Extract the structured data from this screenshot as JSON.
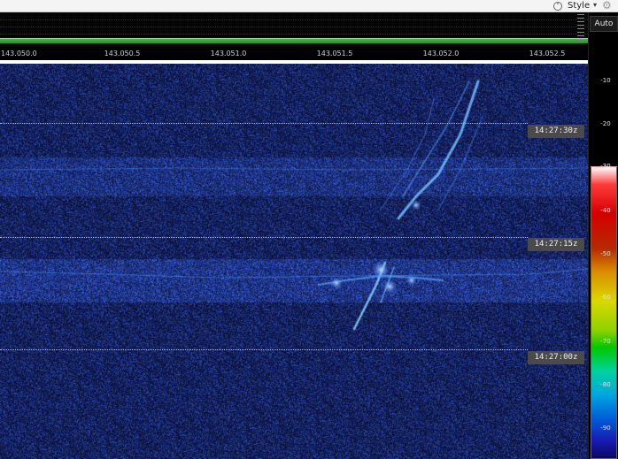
{
  "toolbar": {
    "collapse_icon": "chevron-up-circle-icon",
    "style_label": "Style",
    "style_caret": "▾",
    "settings_icon": "gear-icon"
  },
  "frequency_axis": {
    "ticks": [
      "143.050.0",
      "143.050.5",
      "143.051.0",
      "143.051.5",
      "143.052.0",
      "143.052.5"
    ]
  },
  "waterfall": {
    "timestamps": [
      "14:27:30z",
      "14:27:15z",
      "14:27:00z"
    ]
  },
  "color_scale": {
    "mode_button": "Auto",
    "labels": [
      "-10",
      "-20",
      "-30",
      "-40",
      "-50",
      "-60",
      "-70",
      "-80",
      "-90"
    ]
  },
  "colors": {
    "waterfall_background": "#030a3a",
    "signal": "#5fb4ff",
    "spectrum_level": "#3dbb3d",
    "timestamp_bg": "#4a4a4a"
  }
}
